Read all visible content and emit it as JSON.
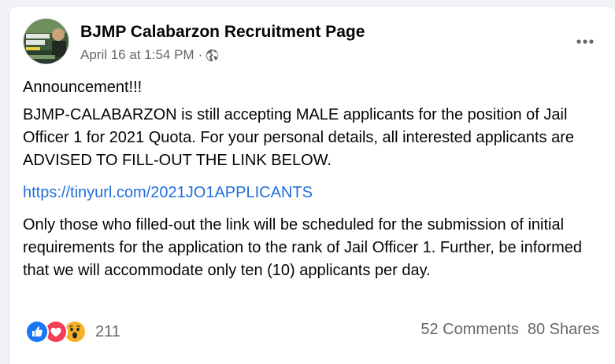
{
  "post": {
    "page_name": "BJMP Calabarzon Recruitment Page",
    "timestamp": "April 16 at 1:54 PM",
    "separator": "·",
    "audience_icon": "globe-icon",
    "avatar_text": "BE A JAIL OFFICER",
    "paragraphs": [
      "Announcement!!!",
      "BJMP-CALABARZON is still accepting MALE applicants for the position of Jail Officer 1 for 2021 Quota. For your personal details, all interested applicants are ADVISED TO FILL-OUT THE LINK BELOW.",
      "Only those who filled-out the link  will be scheduled for the submission of initial requirements for the application to the rank of Jail Officer 1. Further, be informed that we will accommodate only ten (10) applicants per day."
    ],
    "link_text": "https://tinyurl.com/2021JO1APPLICANTS"
  },
  "engagement": {
    "reactions": [
      "like-icon",
      "love-icon",
      "wow-icon"
    ],
    "reaction_count": "211",
    "comments": "52 Comments",
    "shares": "80 Shares"
  },
  "colors": {
    "link": "#216fdb",
    "secondary_text": "#65676b",
    "like": "#1877f2",
    "love": "#f33e58",
    "wow": "#f7b125"
  }
}
